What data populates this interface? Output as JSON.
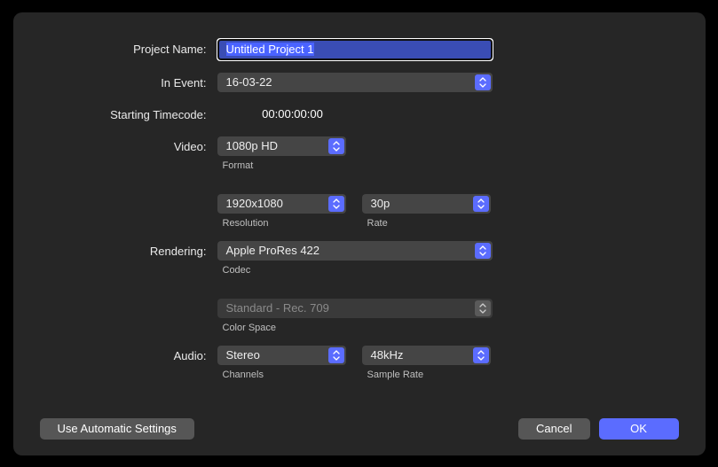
{
  "labels": {
    "projectName": "Project Name:",
    "inEvent": "In Event:",
    "startingTimecode": "Starting Timecode:",
    "video": "Video:",
    "rendering": "Rendering:",
    "audio": "Audio:"
  },
  "sublabels": {
    "format": "Format",
    "resolution": "Resolution",
    "rate": "Rate",
    "codec": "Codec",
    "colorSpace": "Color Space",
    "channels": "Channels",
    "sampleRate": "Sample Rate"
  },
  "values": {
    "projectName": "Untitled Project 1",
    "event": "16-03-22",
    "timecode": "00:00:00:00",
    "videoFormat": "1080p HD",
    "resolution": "1920x1080",
    "rate": "30p",
    "codec": "Apple ProRes 422",
    "colorSpace": "Standard - Rec. 709",
    "audioChannels": "Stereo",
    "sampleRate": "48kHz"
  },
  "buttons": {
    "autoSettings": "Use Automatic Settings",
    "cancel": "Cancel",
    "ok": "OK"
  }
}
